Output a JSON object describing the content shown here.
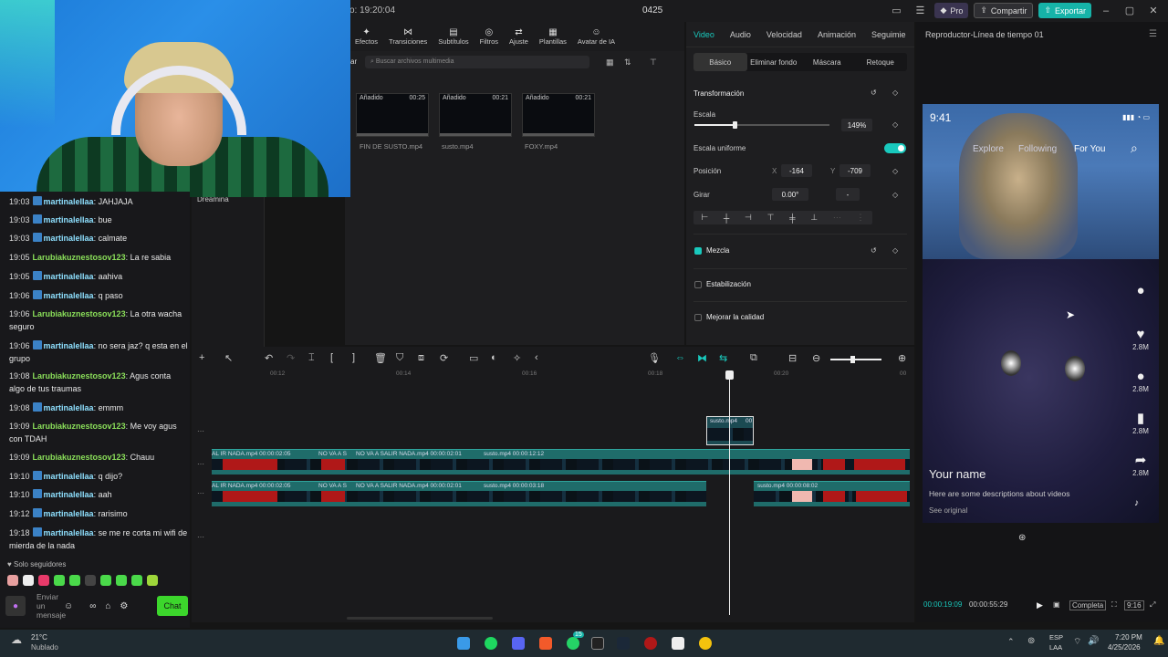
{
  "titlebar": {
    "project_time": "co: 19:20:04",
    "title": "0425",
    "pro": "Pro",
    "share": "Compartir",
    "export": "Exportar"
  },
  "toolbar": {
    "items": [
      "Efectos",
      "Transiciones",
      "Subtítulos",
      "Filtros",
      "Ajuste",
      "Plantillas",
      "Avatar de IA"
    ]
  },
  "media": {
    "search_placeholder": "Buscar archivos multimedia",
    "side_label": "ar",
    "dreamina": "Dreamina",
    "clips": [
      {
        "tag": "Añadido",
        "duration": "00:25",
        "name": "FIN DE SUSTO.mp4"
      },
      {
        "tag": "Añadido",
        "duration": "00:21",
        "name": "susto.mp4"
      },
      {
        "tag": "Añadido",
        "duration": "00:21",
        "name": "FOXY.mp4"
      }
    ]
  },
  "props": {
    "tabs": [
      "Video",
      "Audio",
      "Velocidad",
      "Animación",
      "Seguimie"
    ],
    "subtabs": [
      "Básico",
      "Eliminar fondo",
      "Máscara",
      "Retoque"
    ],
    "transform": "Transformación",
    "scale_label": "Escala",
    "scale_value": "149%",
    "uniform_label": "Escala uniforme",
    "position_label": "Posición",
    "pos_x_label": "X",
    "pos_x": "-164",
    "pos_y_label": "Y",
    "pos_y": "-709",
    "rotate_label": "Girar",
    "rotate_value": "0.00°",
    "rotate_extra": "-",
    "blend": "Mezcla",
    "stabilize": "Estabilización",
    "quality": "Mejorar la calidad"
  },
  "player": {
    "title": "Reproductor-Línea de tiempo 01",
    "phone_time": "9:41",
    "nav": [
      "Explore",
      "Following",
      "For You"
    ],
    "counts": [
      "2.8M",
      "2.8M",
      "2.8M",
      "2.8M"
    ],
    "username": "Your name",
    "description": "Here are some descriptions about videos",
    "see_original": "See original",
    "time_current": "00:00:19:09",
    "time_total": "00:00:55:29",
    "fit": "Completa",
    "ratio": "9:16"
  },
  "timeline": {
    "ruler": [
      "00:12",
      "00:14",
      "00:16",
      "00:18",
      "00:20",
      "00"
    ],
    "overlay_clip": "susto.mp4",
    "overlay_dur": "00",
    "track1_labels": [
      "AL IR NADA.mp4  00:00:02:05",
      "NO VA A S",
      "NO VA A SALIR NADA.mp4  00:00:02:01",
      "susto.mp4  00:00:12:12"
    ],
    "track2_labels": [
      "AL IR NADA.mp4  00:00:02:05",
      "NO VA A S",
      "NO VA A SALIR NADA.mp4  00:00:02:01",
      "susto.mp4  00:00:03:18",
      "susto.mp4  00:00:08:02"
    ]
  },
  "chat": {
    "messages": [
      {
        "time": "19:03",
        "user": "martinalellaa",
        "text": "JAHJAJA",
        "color": "u1"
      },
      {
        "time": "19:03",
        "user": "martinalellaa",
        "text": "bue",
        "color": "u1"
      },
      {
        "time": "19:03",
        "user": "martinalellaa",
        "text": "calmate",
        "color": "u1"
      },
      {
        "time": "19:05",
        "user": "Larubiakuznestosov123",
        "text": "La re sabia",
        "color": "u2"
      },
      {
        "time": "19:05",
        "user": "martinalellaa",
        "text": "aahiva",
        "color": "u1"
      },
      {
        "time": "19:06",
        "user": "martinalellaa",
        "text": "q paso",
        "color": "u1"
      },
      {
        "time": "19:06",
        "user": "Larubiakuznestosov123",
        "text": "La otra wacha seguro",
        "color": "u2"
      },
      {
        "time": "19:06",
        "user": "martinalellaa",
        "text": "no sera jaz? q esta en el grupo",
        "color": "u1"
      },
      {
        "time": "19:08",
        "user": "Larubiakuznestosov123",
        "text": "Agus conta algo de tus traumas",
        "color": "u2"
      },
      {
        "time": "19:08",
        "user": "martinalellaa",
        "text": "emmm",
        "color": "u1"
      },
      {
        "time": "19:09",
        "user": "Larubiakuznestosov123",
        "text": "Me voy agus con TDAH",
        "color": "u2"
      },
      {
        "time": "19:09",
        "user": "Larubiakuznestosov123",
        "text": "Chauu",
        "color": "u2"
      },
      {
        "time": "19:10",
        "user": "martinalellaa",
        "text": "q dijo?",
        "color": "u1"
      },
      {
        "time": "19:10",
        "user": "martinalellaa",
        "text": "aah",
        "color": "u1"
      },
      {
        "time": "19:12",
        "user": "martinalellaa",
        "text": "rarisimo",
        "color": "u1"
      },
      {
        "time": "19:18",
        "user": "martinalellaa",
        "text": "se me re corta mi wifi de mierda de la nada",
        "color": "u1"
      }
    ],
    "followers_only": "Solo seguidores",
    "input_placeholder": "Enviar un mensaje",
    "chat_button": "Chat"
  },
  "taskbar": {
    "temp": "21°C",
    "weather": "Nublado",
    "lang1": "ESP",
    "lang2": "LAA",
    "time": "7:20 PM",
    "date": "4/25/2026",
    "badge": "15"
  }
}
